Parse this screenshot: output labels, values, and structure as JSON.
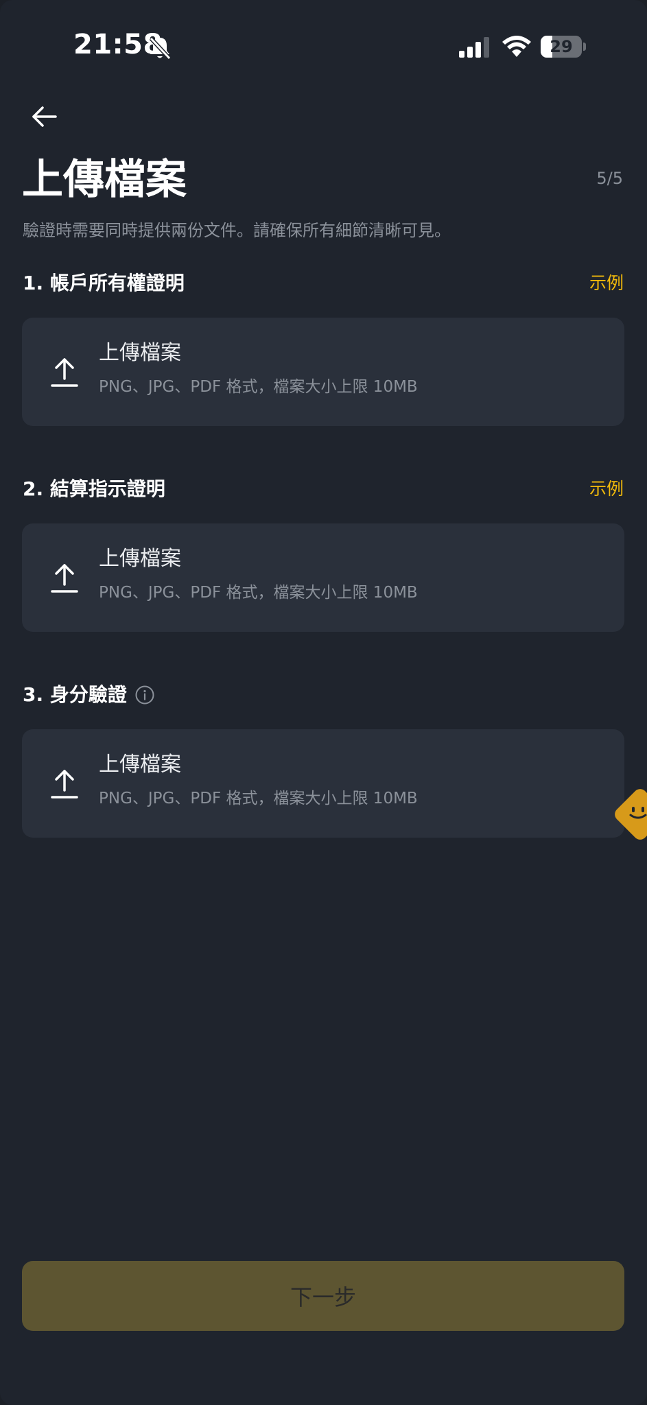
{
  "status_bar": {
    "time": "21:58",
    "battery_level": "29",
    "battery_fraction": 0.29,
    "icons": [
      "bell-off-icon",
      "signal-icon",
      "wifi-icon",
      "battery-icon"
    ]
  },
  "header": {
    "back_icon": "arrow-left-icon",
    "title": "上傳檔案",
    "step": "5/5",
    "description": "驗證時需要同時提供兩份文件。請確保所有細節清晰可見。"
  },
  "sections": [
    {
      "title": "1. 帳戶所有權證明",
      "example_label": "示例",
      "upload_label": "上傳檔案",
      "upload_hint": "PNG、JPG、PDF 格式，檔案大小上限 10MB"
    },
    {
      "title": "2. 結算指示證明",
      "example_label": "示例",
      "upload_label": "上傳檔案",
      "upload_hint": "PNG、JPG、PDF 格式，檔案大小上限 10MB"
    },
    {
      "title": "3. 身分驗證",
      "info_icon": "info-icon",
      "upload_label": "上傳檔案",
      "upload_hint": "PNG、JPG、PDF 格式，檔案大小上限 10MB"
    }
  ],
  "footer": {
    "next_label": "下一步"
  },
  "colors": {
    "background": "#1f242d",
    "card": "#2a303b",
    "accent": "#f0b90b",
    "button_disabled": "#5d5531",
    "muted_text": "#8b919a"
  }
}
